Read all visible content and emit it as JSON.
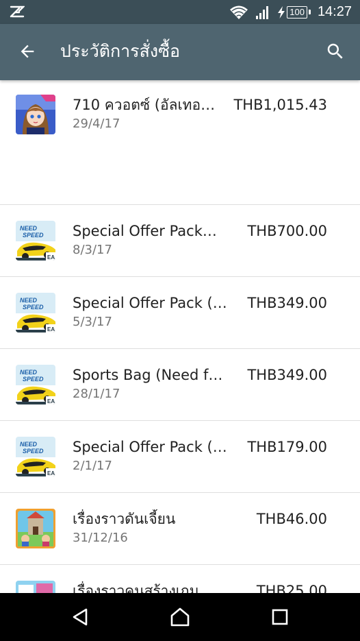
{
  "status_bar": {
    "time": "14:27",
    "battery": "100",
    "icons": [
      "notification-app-icon",
      "wifi-icon",
      "signal-icon",
      "charging-icon",
      "battery-icon"
    ]
  },
  "toolbar": {
    "title": "ประวัติการสั่งซื้อ",
    "back_icon": "arrow-back-icon",
    "search_icon": "search-icon",
    "color": "#4f6570"
  },
  "purchases": [
    {
      "name": "710 ควอตซ์ (อัลเทอ…",
      "date": "29/4/17",
      "price": "THB1,015.43",
      "icon": "anime-game-icon"
    },
    {
      "name": "Special Offer Pack……",
      "date": "8/3/17",
      "price": "THB700.00",
      "icon": "need-for-speed-icon"
    },
    {
      "name": "Special Offer Pack (…",
      "date": "5/3/17",
      "price": "THB349.00",
      "icon": "need-for-speed-icon"
    },
    {
      "name": "Sports Bag (Need for…",
      "date": "28/1/17",
      "price": "THB349.00",
      "icon": "need-for-speed-icon"
    },
    {
      "name": "Special Offer Pack (…",
      "date": "2/1/17",
      "price": "THB179.00",
      "icon": "need-for-speed-icon"
    },
    {
      "name": "เรื่องราวดันเจี้ยน",
      "date": "31/12/16",
      "price": "THB46.00",
      "icon": "dungeon-game-icon"
    },
    {
      "name": "เรื่องราวคนสร้างเกม",
      "date": "",
      "price": "THB25.00",
      "icon": "game-dev-story-icon"
    }
  ],
  "nav_bar": {
    "back": "triangle-back-icon",
    "home": "home-icon",
    "recents": "recents-icon"
  }
}
